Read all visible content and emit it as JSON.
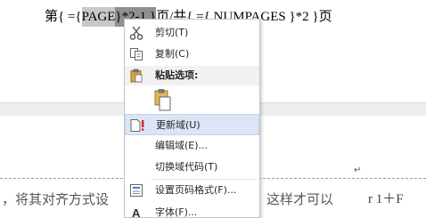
{
  "document": {
    "field_line": {
      "p1": "第{ ={ ",
      "p2": "PAGE",
      "p3": "  }*2-1 }",
      "p4": "页/共{ ={ NUMPAGES   }*2 }页"
    },
    "paragraph_mark": "↵",
    "body_text_left": "，将其对齐方式设",
    "body_text_right": "这样才可以",
    "body_formula": "r 1＋F"
  },
  "context_menu": {
    "cut_label": "剪切(T)",
    "copy_label": "复制(C)",
    "paste_options_label": "粘贴选项:",
    "update_field_label": "更新域(U)",
    "edit_field_label": "编辑域(E)...",
    "toggle_codes_label": "切换域代码(T)",
    "page_number_format_label": "设置页码格式(F)...",
    "font_label": "字体(F)..."
  },
  "colors": {
    "highlight": "#dbe5f6",
    "selection": "#c8c8c8",
    "accent_red": "#d9251c"
  }
}
